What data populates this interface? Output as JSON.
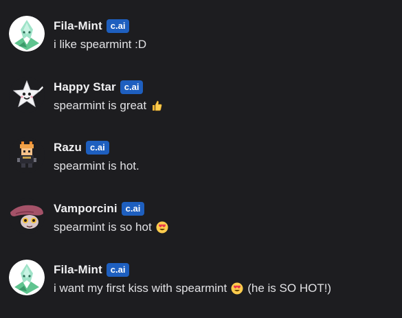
{
  "messages": [
    {
      "username": "Fila-Mint",
      "badge": "c.ai",
      "avatar_icon": "mint-leaf-character-avatar",
      "text_before": "i like spearmint :D",
      "emoji": null,
      "text_after": ""
    },
    {
      "username": "Happy Star",
      "badge": "c.ai",
      "avatar_icon": "white-star-character-avatar",
      "text_before": "spearmint is great",
      "emoji": "thumbs-up-emoji",
      "text_after": ""
    },
    {
      "username": "Razu",
      "badge": "c.ai",
      "avatar_icon": "pixel-warrior-avatar",
      "text_before": "spearmint is hot.",
      "emoji": null,
      "text_after": ""
    },
    {
      "username": "Vamporcini",
      "badge": "c.ai",
      "avatar_icon": "mushroom-creature-avatar",
      "text_before": "spearmint is so hot",
      "emoji": "heart-eyes-emoji",
      "text_after": ""
    },
    {
      "username": "Fila-Mint",
      "badge": "c.ai",
      "avatar_icon": "mint-leaf-character-avatar",
      "text_before": "i want my first kiss with spearmint",
      "emoji": "heart-eyes-emoji",
      "text_after": "(he is SO HOT!)"
    }
  ],
  "colors": {
    "background": "#1d1d20",
    "badge": "#1e5fbf",
    "text": "#e2e2e5"
  }
}
